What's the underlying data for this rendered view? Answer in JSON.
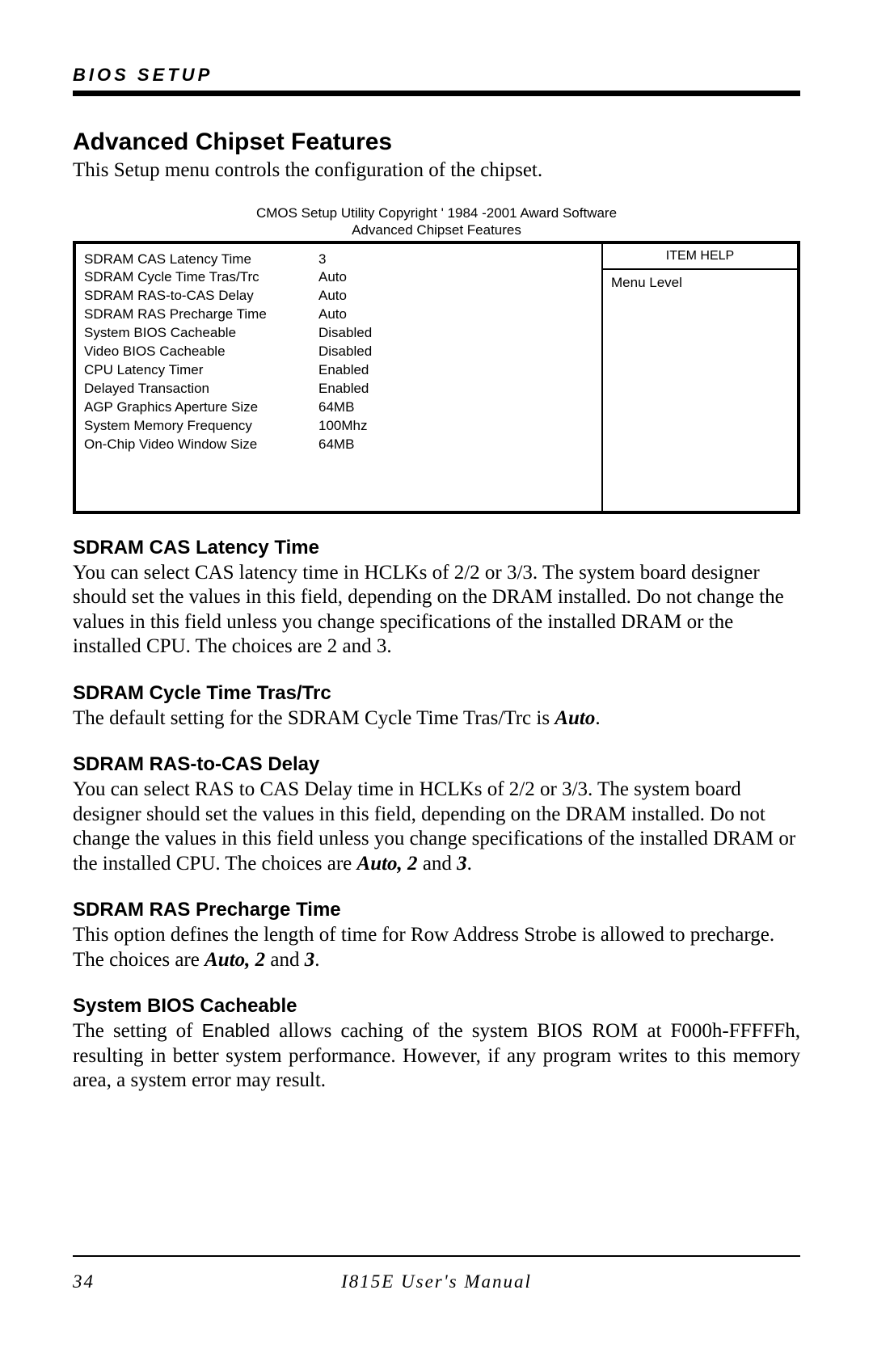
{
  "header": {
    "label": "BIOS SETUP"
  },
  "title": "Advanced Chipset Features",
  "intro": "This Setup menu controls the configuration of the chipset.",
  "cmos": {
    "caption_line1": "CMOS Setup Utility    Copyright ' 1984 -2001 Award Software",
    "caption_line2": "Advanced Chipset Features",
    "rows": [
      {
        "label": "SDRAM CAS Latency Time",
        "value": "3"
      },
      {
        "label": "SDRAM Cycle Time Tras/Trc",
        "value": "Auto"
      },
      {
        "label": "SDRAM RAS-to-CAS Delay",
        "value": "Auto"
      },
      {
        "label": "SDRAM RAS Precharge Time",
        "value": "Auto"
      },
      {
        "label": "System BIOS Cacheable",
        "value": "Disabled"
      },
      {
        "label": "Video BIOS Cacheable",
        "value": "Disabled"
      },
      {
        "label": "CPU Latency Timer",
        "value": "Enabled"
      },
      {
        "label": "Delayed Transaction",
        "value": "Enabled"
      },
      {
        "label": "AGP Graphics Aperture Size",
        "value": "64MB"
      },
      {
        "label": "System Memory Frequency",
        "value": "100Mhz"
      },
      {
        "label": "On-Chip Video Window Size",
        "value": "64MB"
      }
    ],
    "help_title": "ITEM HELP",
    "help_body": "Menu Level"
  },
  "sections": {
    "s1": {
      "heading": "SDRAM CAS Latency Time",
      "body": "You can select CAS latency time in HCLKs of 2/2 or 3/3. The system board designer should set the values in this field, depending on the DRAM installed. Do not change the values in this field unless you change specifications of the installed DRAM or the installed CPU. The choices are 2 and 3."
    },
    "s2": {
      "heading": "SDRAM Cycle Time Tras/Trc",
      "body_pre": "The default setting for the SDRAM Cycle Time Tras/Trc is ",
      "body_bi": "Auto",
      "body_post": "."
    },
    "s3": {
      "heading": "SDRAM RAS-to-CAS Delay",
      "body_pre": "You can select RAS to CAS Delay time in HCLKs of 2/2 or 3/3. The system board designer should set the values in this field, depending on the DRAM installed. Do not change the values in this field unless you change specifications of the installed DRAM or the installed CPU. The choices are ",
      "body_bi1": "Auto, 2",
      "body_mid": " and ",
      "body_bi2": "3",
      "body_post": "."
    },
    "s4": {
      "heading": "SDRAM RAS Precharge Time",
      "body_pre": "This option defines the length of time for Row Address Strobe is allowed to precharge. The choices are ",
      "body_bi1": "Auto, 2",
      "body_mid": " and ",
      "body_bi2": "3",
      "body_post": "."
    },
    "s5": {
      "heading": "System BIOS Cacheable",
      "body_pre": "The setting of ",
      "body_sans": "Enabled",
      "body_post": " allows caching of the system BIOS ROM at F000h-FFFFFh, resulting in better system performance.  However, if any program writes to this memory area, a system error may result."
    }
  },
  "footer": {
    "page": "34",
    "manual": "I815E User's Manual"
  }
}
